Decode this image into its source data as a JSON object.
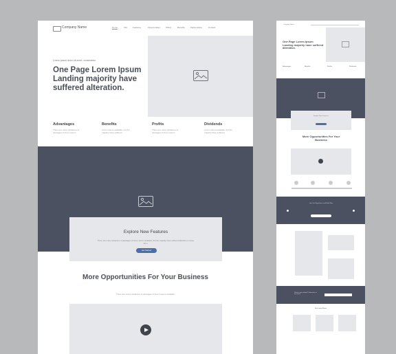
{
  "nav": {
    "logo": "Company Name",
    "items": [
      "Home",
      "Info",
      "Features",
      "Opportunities",
      "Offers",
      "Benefits",
      "Partnerships",
      "Contact"
    ]
  },
  "hero": {
    "eyebrow": "Lorem ipsum dolor sit amet, consectetur",
    "title": "One Page Lorem Ipsum Landing majority have suffered alteration."
  },
  "features": [
    {
      "title": "Advantages",
      "text": "There are many variations of passages of lorem ipsum"
    },
    {
      "title": "Benefits",
      "text": "Lorem ipsum available, but the majority have suffered"
    },
    {
      "title": "Profits",
      "text": "There are many variations of passages of lorem ipsum"
    },
    {
      "title": "Dividends",
      "text": "Lorem ipsum available, but the majority have suffered"
    }
  ],
  "explore": {
    "title": "Explore New Features",
    "text": "There are many variations of passages of lorem ipsum available, but the majority have suffered alteration in some form.",
    "button": "Get Started"
  },
  "opportunities": {
    "title": "More Opportunities For Your Business",
    "text": "There are many variations of passages of lorem ipsum available"
  },
  "mini": {
    "logo": "Company Name",
    "hero_title": "One Page Lorem Ipsum Landing majority have suffered alteration.",
    "features": [
      "Advantages",
      "Benefits",
      "Profits",
      "Dividends"
    ],
    "explore_title": "Explore New Features",
    "opportunities_title": "More Opportunities For Your Business",
    "dark_title": "Join Our Experience and Build Now",
    "subscribe_title": "Want to get notified? Subscribe to our news",
    "articles_title": "Our Latest News"
  },
  "colors": {
    "dark_band": "#4b5160",
    "accent": "#4a6ea6",
    "placeholder": "#e5e7ea",
    "background": "#b7b9bb"
  }
}
